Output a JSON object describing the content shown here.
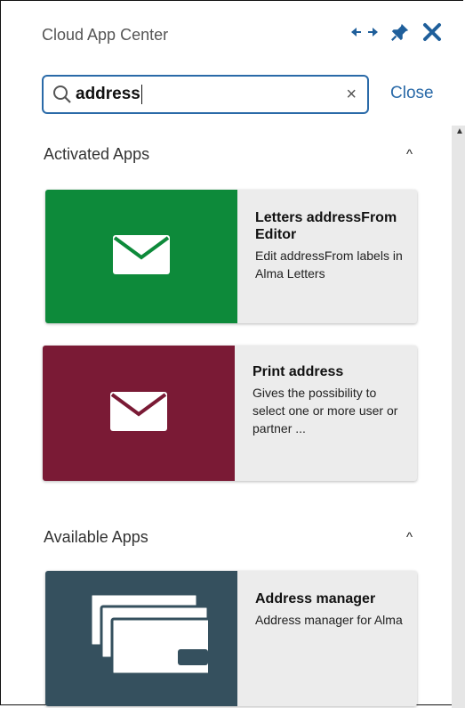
{
  "header": {
    "title": "Cloud App Center",
    "icons": [
      "expand-arrows-icon",
      "pin-icon",
      "close-icon"
    ]
  },
  "search": {
    "value": "address",
    "clear_label": "×",
    "close_label": "Close"
  },
  "sections": {
    "activated": {
      "title": "Activated Apps",
      "toggle": "^",
      "apps": [
        {
          "title": "Letters addressFrom Editor",
          "desc": "Edit addressFrom labels in Alma Letters",
          "color": "#0d8a3a",
          "icon": "envelope-icon"
        },
        {
          "title": "Print address",
          "desc": "Gives the possibility to select one or more user or partner ...",
          "color": "#7a1a35",
          "icon": "envelope-icon"
        }
      ]
    },
    "available": {
      "title": "Available Apps",
      "toggle": "^",
      "apps": [
        {
          "title": "Address manager",
          "desc": "Address manager for Alma",
          "color": "#35505e",
          "icon": "stacked-cards-icon"
        }
      ]
    }
  },
  "colors": {
    "accent": "#2a6aa8",
    "scrollbar": "#e6e6e6"
  }
}
